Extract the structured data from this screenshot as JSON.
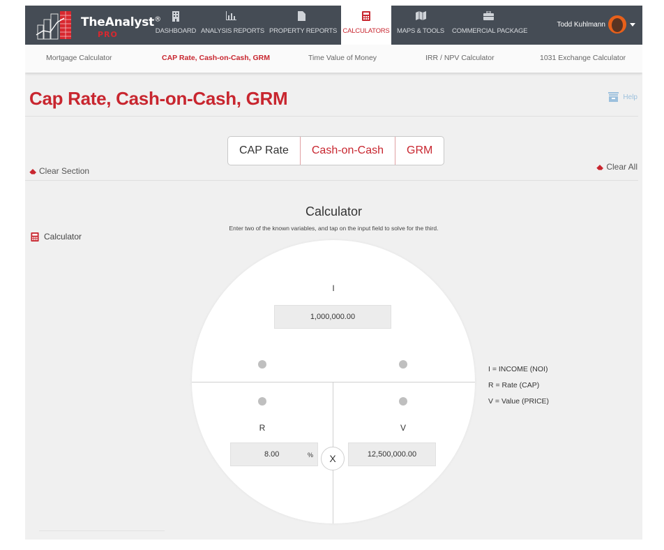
{
  "brand": {
    "name": "TheAnalyst",
    "mark": "®",
    "tier": "PRO"
  },
  "nav": {
    "items": [
      {
        "label": "DASHBOARD",
        "icon": "building-icon"
      },
      {
        "label": "ANALYSIS REPORTS",
        "icon": "bar-chart-icon"
      },
      {
        "label": "PROPERTY REPORTS",
        "icon": "document-icon"
      },
      {
        "label": "CALCULATORS",
        "icon": "calculator-icon",
        "active": true
      },
      {
        "label": "MAPS & TOOLS",
        "icon": "map-icon"
      },
      {
        "label": "COMMERCIAL PACKAGE",
        "icon": "briefcase-icon"
      }
    ],
    "user_name": "Todd Kuhlmann"
  },
  "subnav": {
    "items": [
      {
        "label": "Mortgage Calculator"
      },
      {
        "label": "CAP Rate, Cash-on-Cash, GRM",
        "active": true
      },
      {
        "label": "Time Value of Money"
      },
      {
        "label": "IRR / NPV Calculator"
      },
      {
        "label": "1031 Exchange Calculator"
      }
    ]
  },
  "page": {
    "title": "Cap Rate, Cash-on-Cash, GRM",
    "help_label": "Help",
    "tabs": [
      "CAP Rate",
      "Cash-on-Cash",
      "GRM"
    ],
    "clear_section_label": "Clear Section",
    "clear_all_label": "Clear All",
    "side_calculator_label": "Calculator"
  },
  "calculator": {
    "title": "Calculator",
    "subtitle": "Enter two of the known variables, and tap on the input field to solve for the third.",
    "income_label": "I",
    "income_value": "1,000,000.00",
    "rate_label": "R",
    "rate_value": "8.00",
    "rate_unit": "%",
    "value_label": "V",
    "value_value": "12,500,000.00",
    "multiply_label": "X"
  },
  "legend": {
    "income": "I = INCOME (NOI)",
    "rate": "R = Rate (CAP)",
    "value": "V = Value (PRICE)"
  },
  "colors": {
    "accent": "#c8262f",
    "nav_bg": "#454c55",
    "page_bg": "#f0f0f0"
  }
}
